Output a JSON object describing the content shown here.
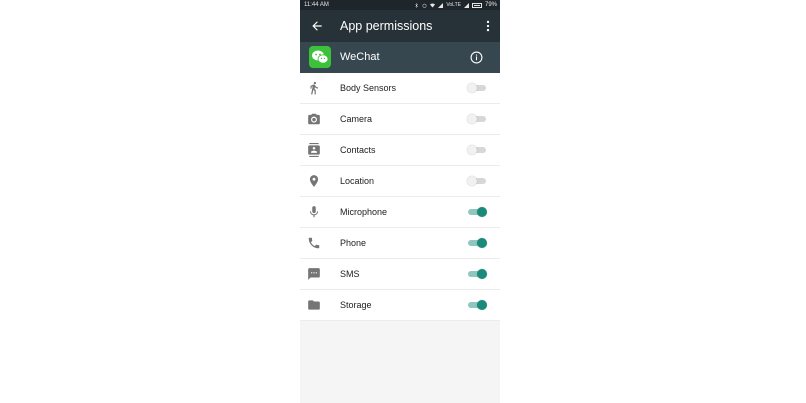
{
  "status_bar": {
    "time": "11:44 AM",
    "battery": "79%"
  },
  "app_bar": {
    "title": "App permissions",
    "back_icon": "arrow-back-icon",
    "more_icon": "more-vert-icon"
  },
  "app": {
    "name": "WeChat",
    "info_icon": "info-icon"
  },
  "colors": {
    "app_bar": "#263238",
    "app_header": "#37474f",
    "accent": "#1a8a7a",
    "wechat_green": "#3cc13a"
  },
  "permissions": [
    {
      "label": "Body Sensors",
      "icon": "walk-icon",
      "enabled": false
    },
    {
      "label": "Camera",
      "icon": "camera-icon",
      "enabled": false
    },
    {
      "label": "Contacts",
      "icon": "contacts-icon",
      "enabled": false
    },
    {
      "label": "Location",
      "icon": "location-icon",
      "enabled": false
    },
    {
      "label": "Microphone",
      "icon": "microphone-icon",
      "enabled": true
    },
    {
      "label": "Phone",
      "icon": "phone-icon",
      "enabled": true
    },
    {
      "label": "SMS",
      "icon": "sms-icon",
      "enabled": true
    },
    {
      "label": "Storage",
      "icon": "folder-icon",
      "enabled": true
    }
  ]
}
